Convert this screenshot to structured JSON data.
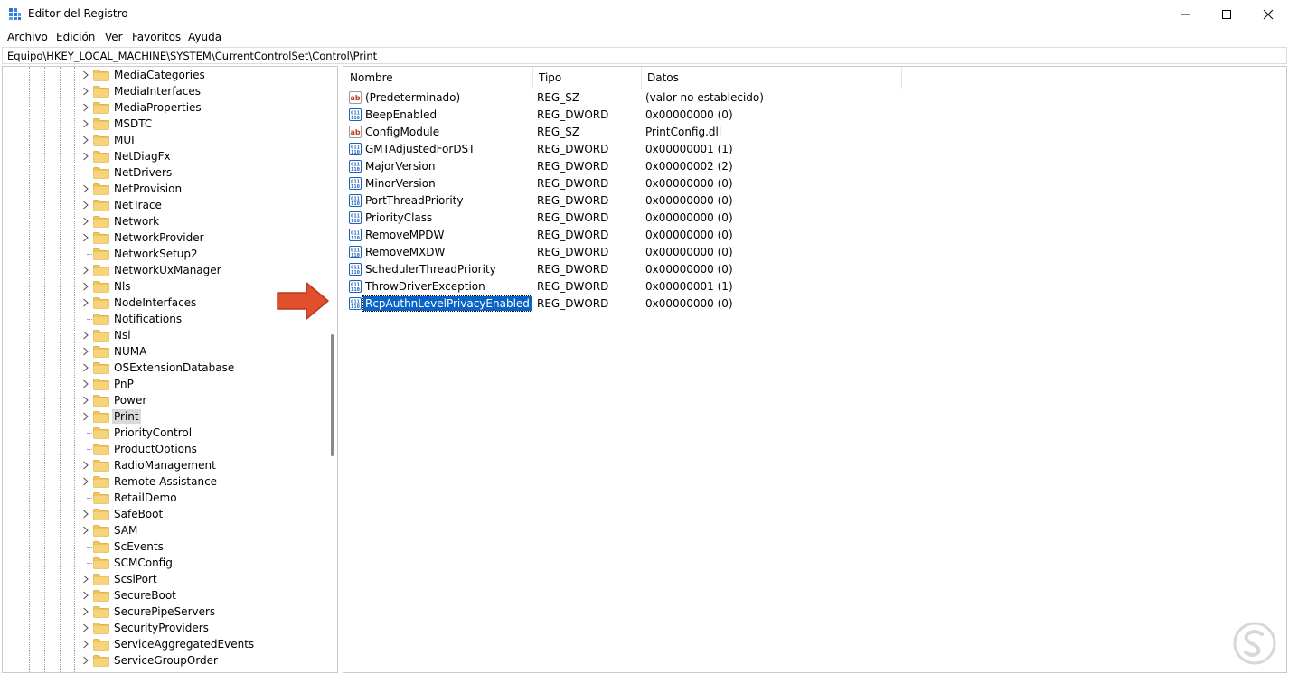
{
  "window": {
    "title": "Editor del Registro",
    "icon": "regedit-icon"
  },
  "menu": [
    "Archivo",
    "Edición",
    "Ver",
    "Favoritos",
    "Ayuda"
  ],
  "address": "Equipo\\HKEY_LOCAL_MACHINE\\SYSTEM\\CurrentControlSet\\Control\\Print",
  "tree": {
    "items": [
      {
        "label": "MediaCategories",
        "expandable": true
      },
      {
        "label": "MediaInterfaces",
        "expandable": true
      },
      {
        "label": "MediaProperties",
        "expandable": true
      },
      {
        "label": "MSDTC",
        "expandable": true
      },
      {
        "label": "MUI",
        "expandable": true
      },
      {
        "label": "NetDiagFx",
        "expandable": true
      },
      {
        "label": "NetDrivers",
        "expandable": false
      },
      {
        "label": "NetProvision",
        "expandable": true
      },
      {
        "label": "NetTrace",
        "expandable": true
      },
      {
        "label": "Network",
        "expandable": true
      },
      {
        "label": "NetworkProvider",
        "expandable": true
      },
      {
        "label": "NetworkSetup2",
        "expandable": false
      },
      {
        "label": "NetworkUxManager",
        "expandable": true
      },
      {
        "label": "Nls",
        "expandable": true
      },
      {
        "label": "NodeInterfaces",
        "expandable": true
      },
      {
        "label": "Notifications",
        "expandable": false
      },
      {
        "label": "Nsi",
        "expandable": true
      },
      {
        "label": "NUMA",
        "expandable": true
      },
      {
        "label": "OSExtensionDatabase",
        "expandable": true
      },
      {
        "label": "PnP",
        "expandable": true
      },
      {
        "label": "Power",
        "expandable": true
      },
      {
        "label": "Print",
        "expandable": true,
        "selected": true
      },
      {
        "label": "PriorityControl",
        "expandable": false
      },
      {
        "label": "ProductOptions",
        "expandable": false
      },
      {
        "label": "RadioManagement",
        "expandable": true
      },
      {
        "label": "Remote Assistance",
        "expandable": true
      },
      {
        "label": "RetailDemo",
        "expandable": false
      },
      {
        "label": "SafeBoot",
        "expandable": true
      },
      {
        "label": "SAM",
        "expandable": true
      },
      {
        "label": "ScEvents",
        "expandable": false
      },
      {
        "label": "SCMConfig",
        "expandable": false
      },
      {
        "label": "ScsiPort",
        "expandable": true
      },
      {
        "label": "SecureBoot",
        "expandable": true
      },
      {
        "label": "SecurePipeServers",
        "expandable": true
      },
      {
        "label": "SecurityProviders",
        "expandable": true
      },
      {
        "label": "ServiceAggregatedEvents",
        "expandable": true
      },
      {
        "label": "ServiceGroupOrder",
        "expandable": true
      }
    ]
  },
  "values": {
    "columns": [
      "Nombre",
      "Tipo",
      "Datos"
    ],
    "rows": [
      {
        "name": "(Predeterminado)",
        "type": "REG_SZ",
        "data": "(valor no establecido)",
        "icon": "string-value-icon"
      },
      {
        "name": "BeepEnabled",
        "type": "REG_DWORD",
        "data": "0x00000000 (0)",
        "icon": "binary-value-icon"
      },
      {
        "name": "ConfigModule",
        "type": "REG_SZ",
        "data": "PrintConfig.dll",
        "icon": "string-value-icon"
      },
      {
        "name": "GMTAdjustedForDST",
        "type": "REG_DWORD",
        "data": "0x00000001 (1)",
        "icon": "binary-value-icon"
      },
      {
        "name": "MajorVersion",
        "type": "REG_DWORD",
        "data": "0x00000002 (2)",
        "icon": "binary-value-icon"
      },
      {
        "name": "MinorVersion",
        "type": "REG_DWORD",
        "data": "0x00000000 (0)",
        "icon": "binary-value-icon"
      },
      {
        "name": "PortThreadPriority",
        "type": "REG_DWORD",
        "data": "0x00000000 (0)",
        "icon": "binary-value-icon"
      },
      {
        "name": "PriorityClass",
        "type": "REG_DWORD",
        "data": "0x00000000 (0)",
        "icon": "binary-value-icon"
      },
      {
        "name": "RemoveMPDW",
        "type": "REG_DWORD",
        "data": "0x00000000 (0)",
        "icon": "binary-value-icon"
      },
      {
        "name": "RemoveMXDW",
        "type": "REG_DWORD",
        "data": "0x00000000 (0)",
        "icon": "binary-value-icon"
      },
      {
        "name": "SchedulerThreadPriority",
        "type": "REG_DWORD",
        "data": "0x00000000 (0)",
        "icon": "binary-value-icon"
      },
      {
        "name": "ThrowDriverException",
        "type": "REG_DWORD",
        "data": "0x00000001 (1)",
        "icon": "binary-value-icon"
      },
      {
        "name": "RcpAuthnLevelPrivacyEnabled",
        "type": "REG_DWORD",
        "data": "0x00000000 (0)",
        "icon": "binary-value-icon",
        "selected": true
      }
    ]
  },
  "colors": {
    "selection": "#0a64c8",
    "folder": "#f2c55c",
    "arrow": "#e0502c"
  }
}
